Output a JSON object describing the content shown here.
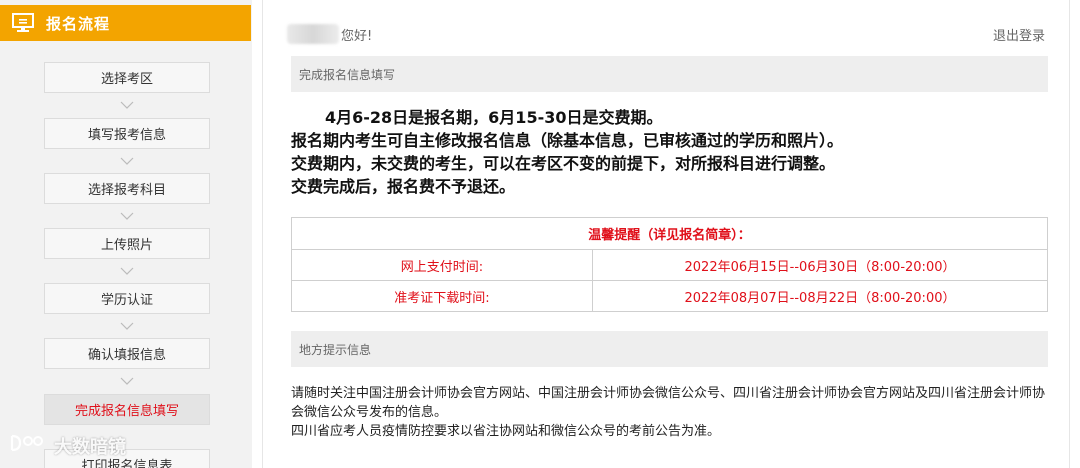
{
  "sidebar": {
    "title": "报名流程",
    "steps": [
      {
        "label": "选择考区"
      },
      {
        "label": "填写报考信息"
      },
      {
        "label": "选择报考科目"
      },
      {
        "label": "上传照片"
      },
      {
        "label": "学历认证"
      },
      {
        "label": "确认填报信息"
      },
      {
        "label": "完成报名信息填写",
        "active": true
      },
      {
        "label": "打印报名信息表"
      }
    ]
  },
  "header": {
    "greeting": "您好!",
    "logout": "退出登录"
  },
  "section1": {
    "title": "完成报名信息填写"
  },
  "notice": {
    "line1": "4月6-28日是报名期，6月15-30日是交费期。",
    "line2": "报名期内考生可自主修改报名信息（除基本信息，已审核通过的学历和照片）。",
    "line3": "交费期内，未交费的考生，可以在考区不变的前提下，对所报科目进行调整。",
    "line4": "交费完成后，报名费不予退还。"
  },
  "reminder": {
    "title": "温馨提醒（详见报名简章）：",
    "rows": [
      {
        "label": "网上支付时间:",
        "value": "2022年06月15日--06月30日（8:00-20:00）"
      },
      {
        "label": "准考证下载时间:",
        "value": "2022年08月07日--08月22日（8:00-20:00）"
      }
    ]
  },
  "section2": {
    "title": "地方提示信息"
  },
  "local_info": {
    "line1": "请随时关注中国注册会计师协会官方网站、中国注册会计师协会微信公众号、四川省注册会计师协会官方网站及四川省注册会计师协会微信公众号发布的信息。",
    "line2": "四川省应考人员疫情防控要求以省注协网站和微信公众号的考前公告为准。"
  },
  "watermark": {
    "text": "大数暗镜"
  },
  "colors": {
    "accent": "#f3a400",
    "alert": "#e0101a"
  }
}
